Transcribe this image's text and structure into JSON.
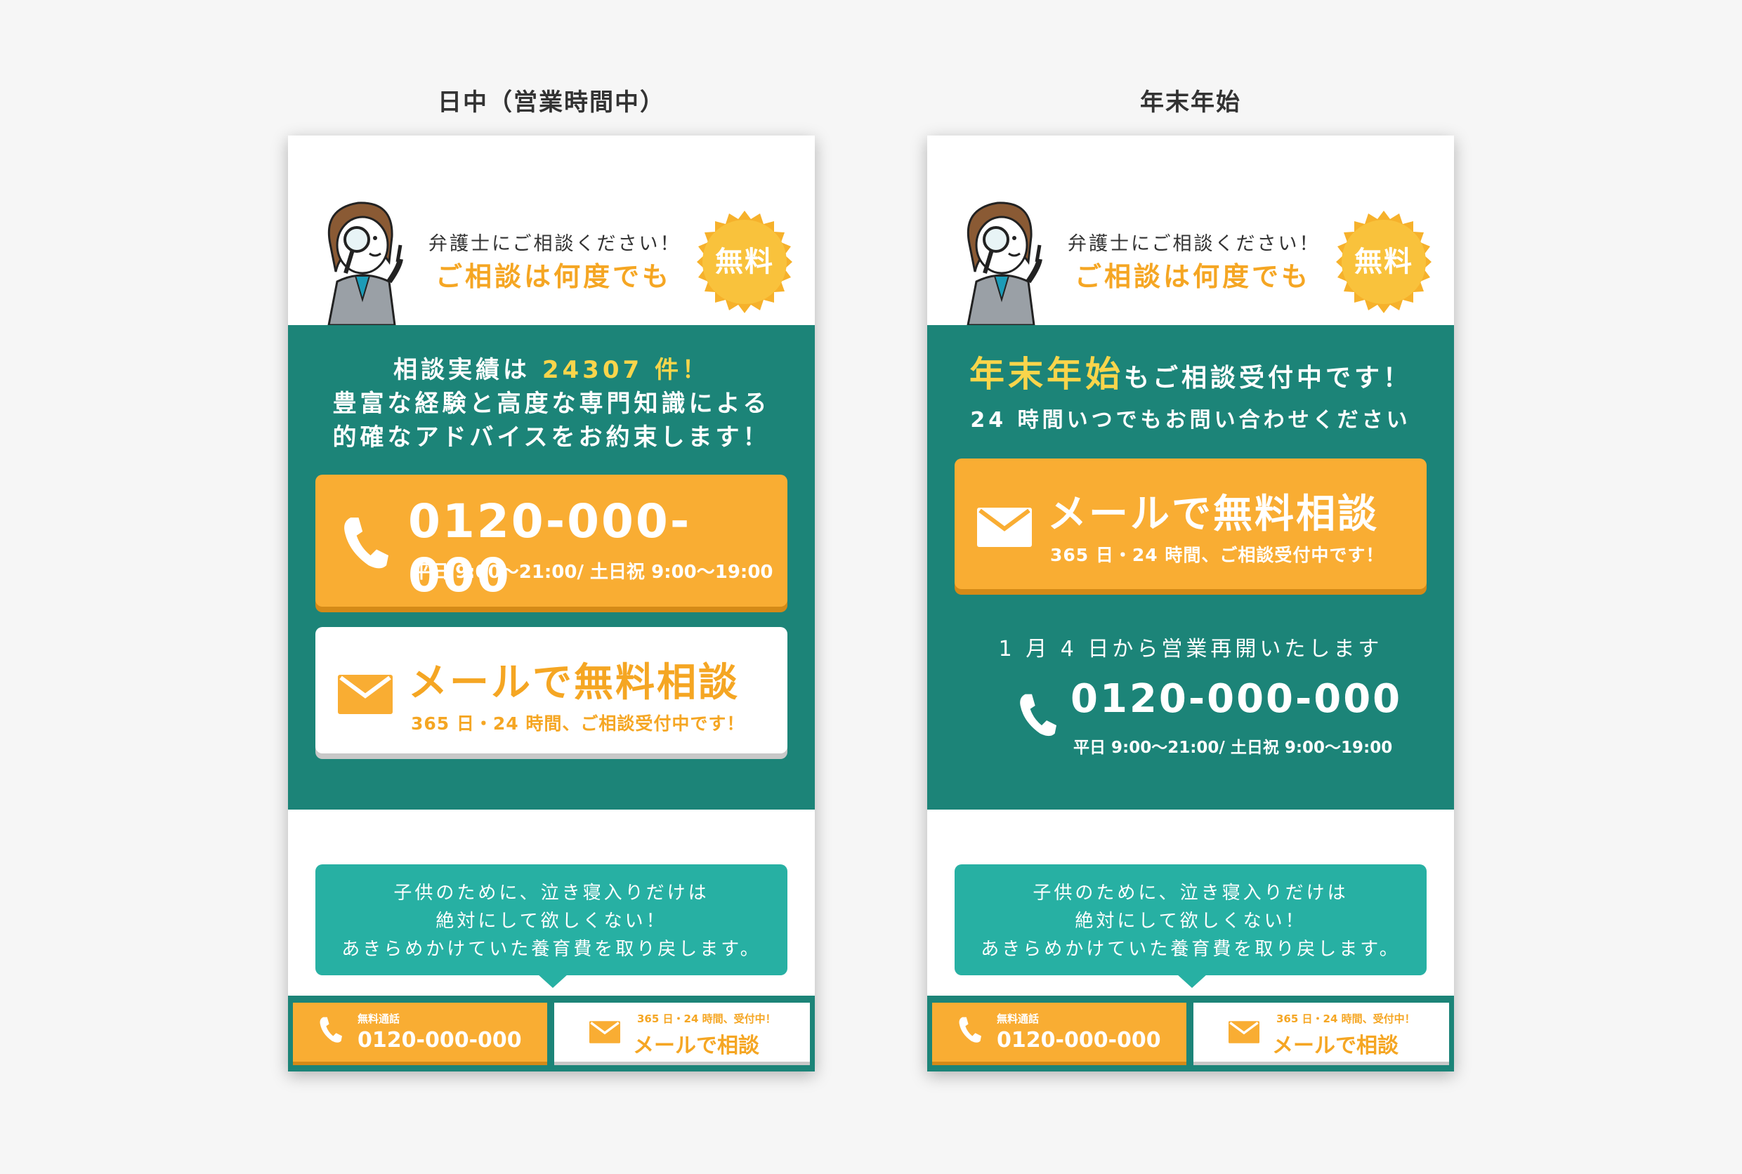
{
  "left": {
    "column_title": "日中（営業時間中）",
    "header": {
      "sub": "弁護士にご相談ください！",
      "main": "ご相談は何度でも",
      "badge": "無料"
    },
    "intro": {
      "line1_prefix": "相談実績は ",
      "line1_count": "24307 件！",
      "line2": "豊富な経験と高度な専門知識による",
      "line3": "的確なアドバイスをお約束します！"
    },
    "tel_button": {
      "number": "0120-000-000",
      "hours": "平日 9:00〜21:00/ 土日祝 9:00〜19:00"
    },
    "mail_button": {
      "label": "メールで無料相談",
      "sub": "365 日・24 時間、ご相談受付中です！"
    },
    "bubble": {
      "line1": "子供のために、泣き寝入りだけは",
      "line2": "絶対にして欲しくない！",
      "line3": "あきらめかけていた養育費を取り戻します。"
    },
    "bottom_bar": {
      "call_small": "無料通話",
      "call_number": "0120-000-000",
      "mail_small": "365 日・24 時間、受付中！",
      "mail_label": "メールで相談"
    }
  },
  "right": {
    "column_title": "年末年始",
    "header": {
      "sub": "弁護士にご相談ください！",
      "main": "ご相談は何度でも",
      "badge": "無料"
    },
    "intro": {
      "line1_accent": "年末年始",
      "line1_rest": "もご相談受付中です！",
      "line2": "24 時間いつでもお問い合わせください"
    },
    "mail_button": {
      "label": "メールで無料相談",
      "sub": "365 日・24 時間、ご相談受付中です！"
    },
    "reopen": {
      "notice": "1 月 4 日から営業再開いたします",
      "number": "0120-000-000",
      "hours": "平日 9:00〜21:00/ 土日祝 9:00〜19:00"
    },
    "bubble": {
      "line1": "子供のために、泣き寝入りだけは",
      "line2": "絶対にして欲しくない！",
      "line3": "あきらめかけていた養育費を取り戻します。"
    },
    "bottom_bar": {
      "call_small": "無料通話",
      "call_number": "0120-000-000",
      "mail_small": "365 日・24 時間、受付中！",
      "mail_label": "メールで相談"
    }
  },
  "icons": {
    "phone": "phone-icon",
    "mail": "mail-icon",
    "mascot": "lawyer-mascot-illustration",
    "badge": "starburst-badge"
  },
  "colors": {
    "teal": "#1c8478",
    "light_teal": "#27b0a3",
    "orange": "#f9ad33",
    "accent_yellow": "#f9d54b",
    "page_bg": "#f6f6f6"
  }
}
